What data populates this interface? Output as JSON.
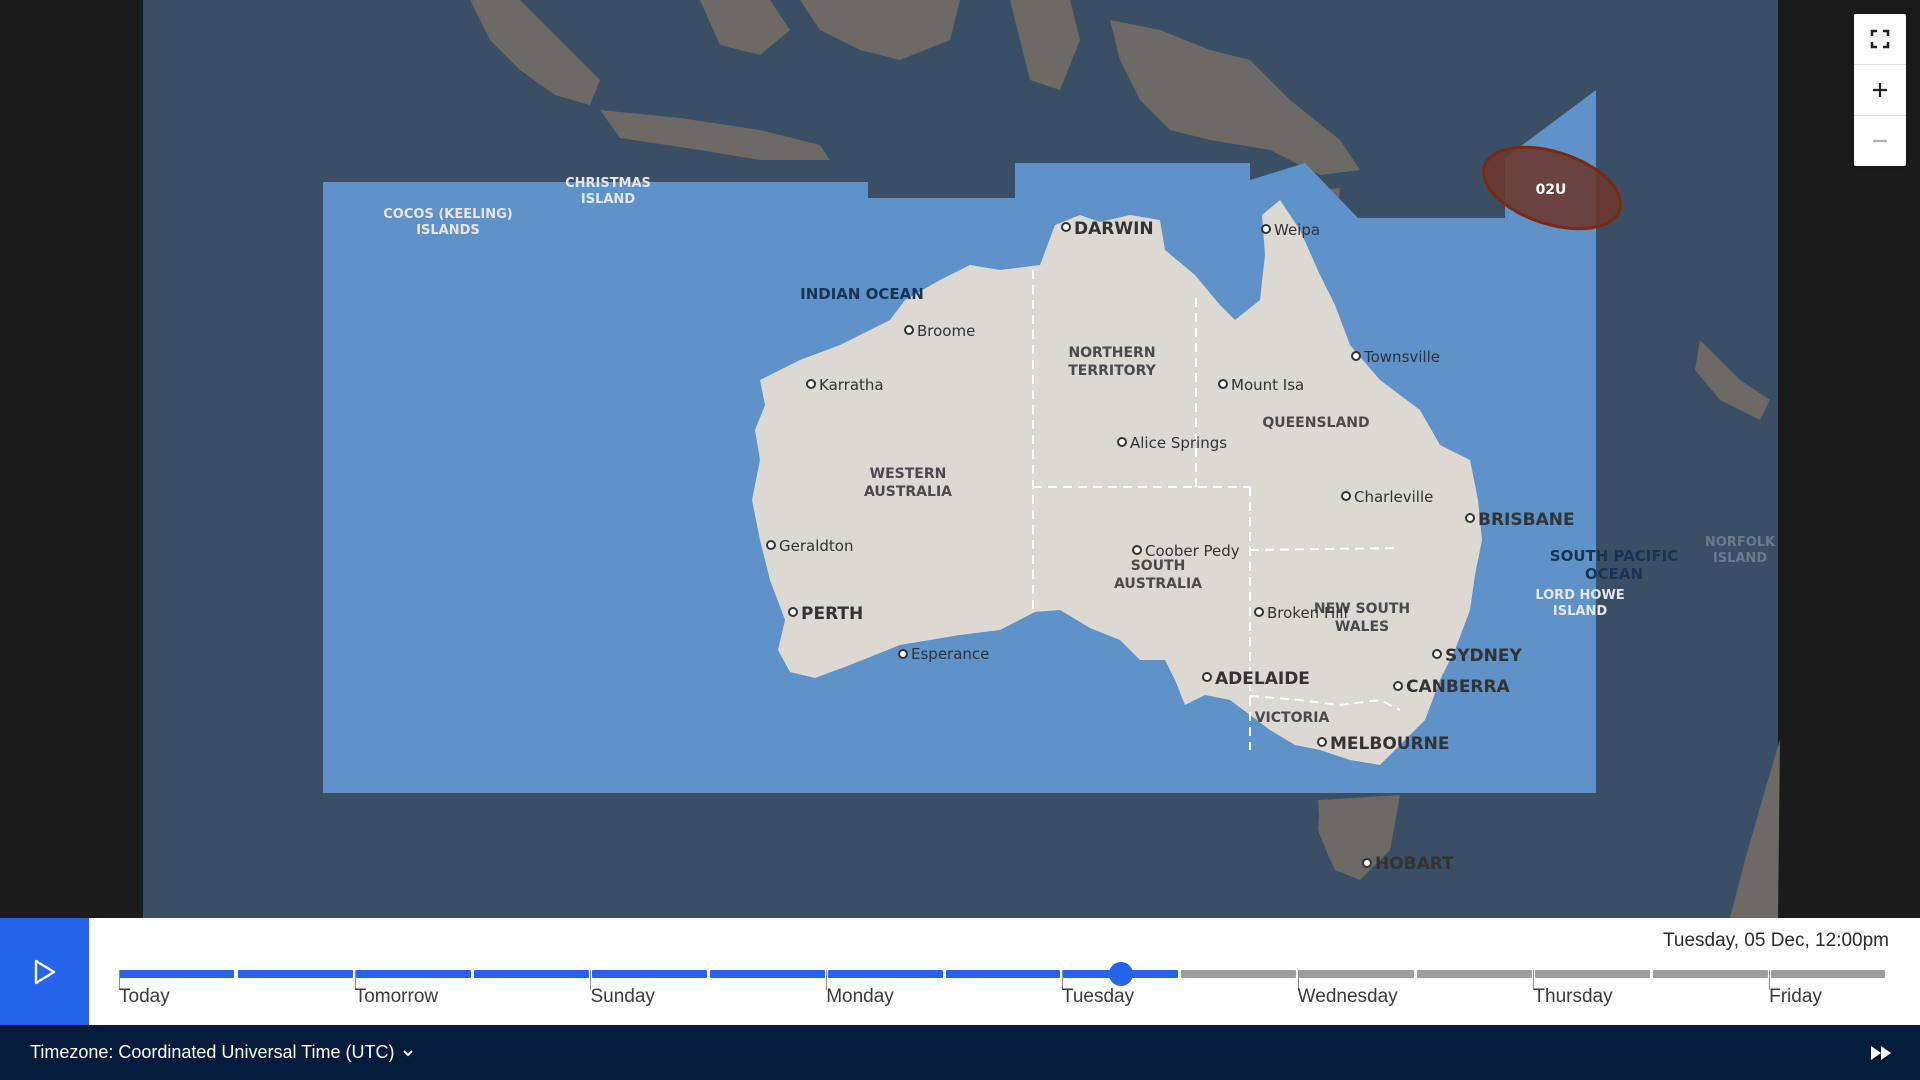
{
  "map": {
    "labels": {
      "indian_ocean": "INDIAN OCEAN",
      "south_pacific_1": "SOUTH PACIFIC",
      "south_pacific_2": "OCEAN",
      "cocos_1": "COCOS (KEELING)",
      "cocos_2": "ISLANDS",
      "christmas_1": "CHRISTMAS",
      "christmas_2": "ISLAND",
      "lord_howe_1": "LORD HOWE",
      "lord_howe_2": "ISLAND",
      "norfolk_1": "NORFOLK",
      "norfolk_2": "ISLAND",
      "nt_1": "NORTHERN",
      "nt_2": "TERRITORY",
      "wa_1": "WESTERN",
      "wa_2": "AUSTRALIA",
      "qld": "QUEENSLAND",
      "sa_1": "SOUTH",
      "sa_2": "AUSTRALIA",
      "nsw_1": "NEW SOUTH",
      "nsw_2": "WALES",
      "vic": "VICTORIA"
    },
    "cities": {
      "darwin": "DARWIN",
      "weipa": "Weipa",
      "broome": "Broome",
      "karratha": "Karratha",
      "townsville": "Townsville",
      "mount_isa": "Mount Isa",
      "alice_springs": "Alice Springs",
      "charleville": "Charleville",
      "brisbane": "BRISBANE",
      "geraldton": "Geraldton",
      "coober_pedy": "Coober Pedy",
      "broken_hill": "Broken Hill",
      "perth": "PERTH",
      "esperance": "Esperance",
      "sydney": "SYDNEY",
      "adelaide": "ADELAIDE",
      "canberra": "CANBERRA",
      "melbourne": "MELBOURNE",
      "hobart": "HOBART"
    },
    "cyclone": {
      "label": "02U",
      "color": "#6b3a30"
    },
    "colors": {
      "outer_sea": "#3a4e66",
      "inner_sea": "#5e92c8",
      "land": "#dcd8d2",
      "outside_land": "#6d6a66"
    },
    "controls": {
      "fullscreen_icon": "fullscreen-icon",
      "zoom_in_icon": "plus-icon",
      "zoom_out_icon": "minus-icon"
    }
  },
  "timeline": {
    "current_datetime": "Tuesday, 05 Dec, 12:00pm",
    "days": [
      "Today",
      "Tomorrow",
      "Sunday",
      "Monday",
      "Tuesday",
      "Wednesday",
      "Thursday",
      "Friday"
    ],
    "segments_total": 15,
    "segments_past": 9,
    "progress": 0.567,
    "colors": {
      "past": "#2563eb",
      "future": "#9e9e9e",
      "accent": "#2563eb"
    }
  },
  "footer": {
    "timezone_label": "Timezone: Coordinated Universal Time (UTC)"
  }
}
